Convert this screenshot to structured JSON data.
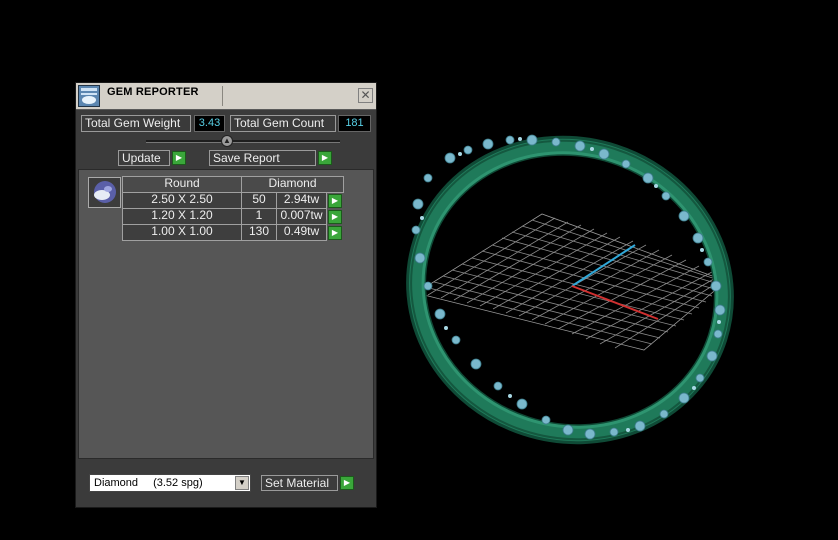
{
  "window": {
    "title": "GEM REPORTER",
    "close_glyph": "✕"
  },
  "stats": {
    "weight_label": "Total Gem Weight",
    "weight_value": "3.43",
    "count_label": "Total Gem Count",
    "count_value": "181"
  },
  "buttons": {
    "update": "Update",
    "save_report": "Save Report",
    "set_material": "Set Material"
  },
  "table": {
    "shape": "Round",
    "material": "Diamond",
    "rows": [
      {
        "size": "2.50 X 2.50",
        "count": "50",
        "weight": "2.94tw"
      },
      {
        "size": "1.20 X 1.20",
        "count": "1",
        "weight": "0.007tw"
      },
      {
        "size": "1.00 X 1.00",
        "count": "130",
        "weight": "0.49tw"
      }
    ]
  },
  "material_select": {
    "value": "Diamond",
    "spg": "(3.52 spg)"
  },
  "icons": {
    "app": "gem-reporter-icon",
    "close": "close-icon",
    "go": "play-arrow-icon",
    "dropdown": "chevron-down-icon",
    "gem": "gem-thumbnail-icon"
  },
  "colors": {
    "ring": "#1f7a5a",
    "gems": "#7ab8cc",
    "axis_x": "#d03030",
    "axis_y": "#30a8d8",
    "grid": "#8a8a8a",
    "value_text": "#58d0e6",
    "go_button": "#3aa63a"
  }
}
